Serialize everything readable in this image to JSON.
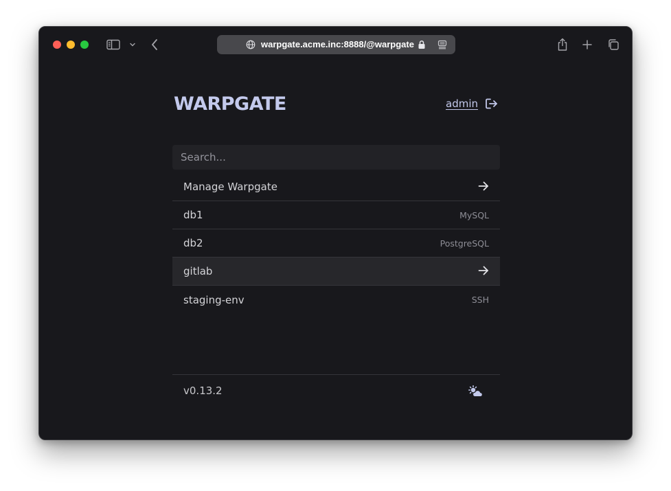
{
  "browser": {
    "url": "warpgate.acme.inc:8888/@warpgate",
    "icons": [
      "sidebar-icon",
      "chevron-down-icon",
      "back-icon",
      "globe-icon",
      "lock-icon",
      "reader-icon",
      "share-icon",
      "plus-icon",
      "tabs-icon"
    ]
  },
  "header": {
    "logo": "WARPGATE",
    "username": "admin"
  },
  "search": {
    "placeholder": "Search..."
  },
  "targets": [
    {
      "name": "Manage Warpgate",
      "kind": "",
      "icon": "arrow-right-icon"
    },
    {
      "name": "db1",
      "kind": "MySQL"
    },
    {
      "name": "db2",
      "kind": "PostgreSQL"
    },
    {
      "name": "gitlab",
      "kind": "",
      "icon": "arrow-right-icon"
    },
    {
      "name": "staging-env",
      "kind": "SSH"
    }
  ],
  "footer": {
    "version": "v0.13.2",
    "theme_icon": "cloud-sun-icon"
  },
  "colors": {
    "background": "#18181c",
    "accent": "#c3c9ec",
    "row_highlight": "#27272b"
  }
}
